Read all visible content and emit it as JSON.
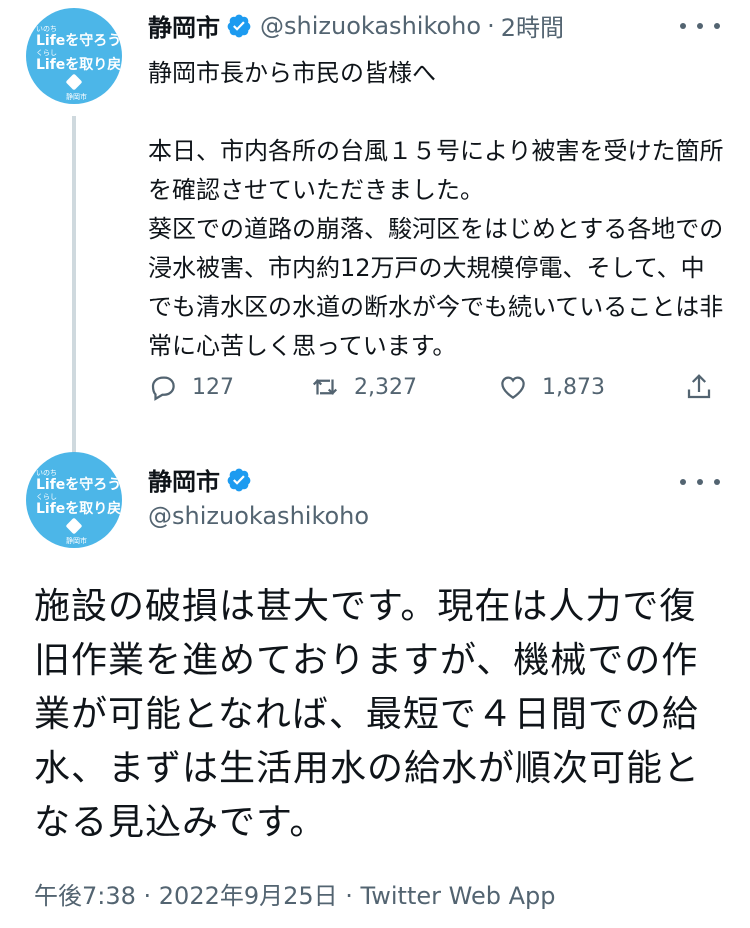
{
  "account": {
    "display_name": "静岡市",
    "handle": "@shizuokashikoho",
    "avatar": {
      "line1": "Lifeを守ろう",
      "line2": "Lifeを取り戻そう",
      "small1": "いのち",
      "small2": "くらし",
      "small3": "静岡市"
    }
  },
  "tweet1": {
    "time": "2時間",
    "body": "静岡市長から市民の皆様へ\n\n本日、市内各所の台風１５号により被害を受けた箇所を確認させていただきました。\n葵区での道路の崩落、駿河区をはじめとする各地での浸水被害、市内約12万戸の大規模停電、そして、中でも清水区の水道の断水が今でも続いていることは非常に心苦しく思っています。",
    "replies": "127",
    "retweets": "2,327",
    "likes": "1,873"
  },
  "tweet2": {
    "body": "施設の破損は甚大です。現在は人力で復旧作業を進めておりますが、機械での作業が可能となれば、最短で４日間での給水、まずは生活用水の給水が順次可能となる見込みです。",
    "timestamp": "午後7:38 · 2022年9月25日 · Twitter Web App"
  },
  "colors": {
    "verified": "#1d9bf0",
    "avatar_bg": "#4cb6e8",
    "muted": "#536471"
  },
  "icons": [
    "verified-badge-icon",
    "more-icon",
    "reply-icon",
    "retweet-icon",
    "like-icon",
    "share-icon"
  ]
}
